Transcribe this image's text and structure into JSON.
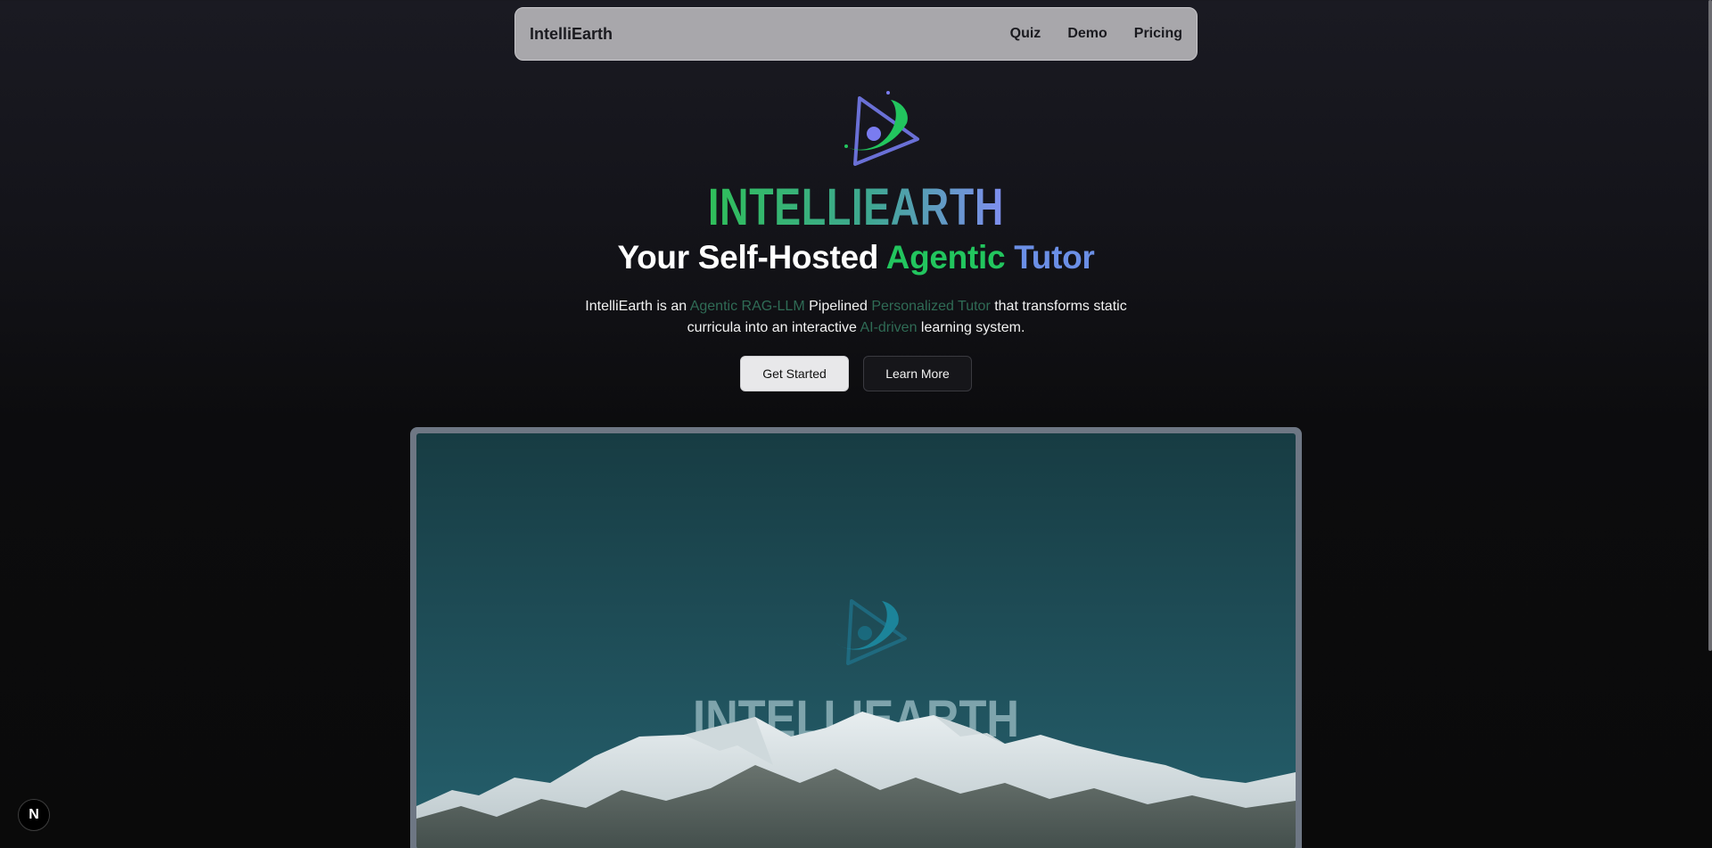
{
  "navbar": {
    "brand": "IntelliEarth",
    "links": [
      "Quiz",
      "Demo",
      "Pricing"
    ]
  },
  "hero": {
    "logo_text": "INTELLIEARTH",
    "headline_main": "Your Self-Hosted",
    "headline_accent_1": "Agentic",
    "headline_accent_2": "Tutor",
    "subtitle_parts": {
      "p1": "IntelliEarth is an ",
      "h1": "Agentic RAG-LLM",
      "p2": " Pipelined ",
      "h2": "Personalized Tutor",
      "p3": " that transforms static curricula into an interactive ",
      "h3": "AI-driven",
      "p4": " learning system."
    },
    "primary_button": "Get Started",
    "secondary_button": "Learn More"
  },
  "media": {
    "video_logo_text": "INTELLIEARTH"
  },
  "badge": {
    "label": "N"
  },
  "colors": {
    "accent_green": "#22c55e",
    "accent_blue": "#6b8fe6",
    "navbar_bg": "#a8a7ab"
  }
}
